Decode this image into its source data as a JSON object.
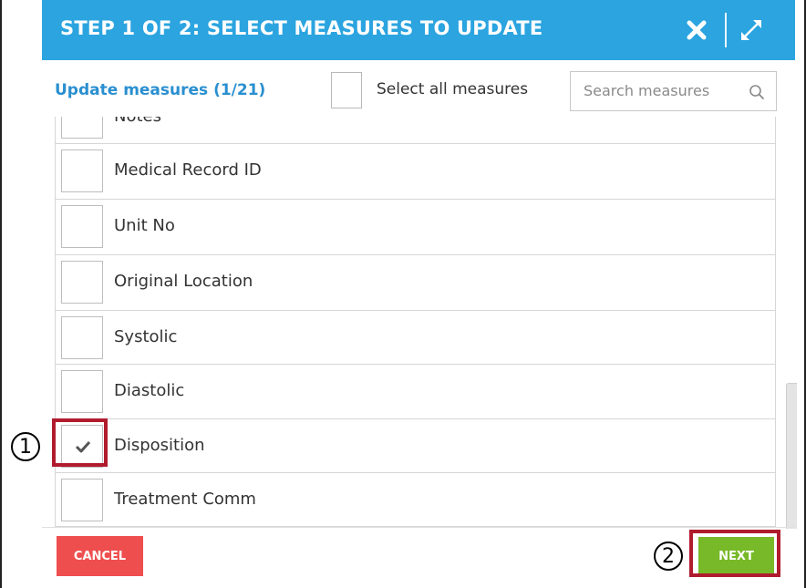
{
  "header": {
    "title": "STEP 1 OF 2: SELECT MEASURES TO UPDATE",
    "close_icon": "close-icon",
    "expand_icon": "expand-icon"
  },
  "toolbar": {
    "title": "Update measures (1/21)",
    "select_all_label": "Select all measures",
    "search_placeholder": "Search measures"
  },
  "measures": [
    {
      "label": "Notes",
      "checked": false
    },
    {
      "label": "Medical Record ID",
      "checked": false
    },
    {
      "label": "Unit No",
      "checked": false
    },
    {
      "label": "Original Location",
      "checked": false
    },
    {
      "label": "Systolic",
      "checked": false
    },
    {
      "label": "Diastolic",
      "checked": false
    },
    {
      "label": "Disposition",
      "checked": true
    },
    {
      "label": "Treatment Comm",
      "checked": false
    }
  ],
  "footer": {
    "cancel_label": "CANCEL",
    "next_label": "NEXT"
  },
  "annotations": {
    "step1": "1",
    "step2": "2"
  },
  "colors": {
    "header_bg": "#2ba4e0",
    "title_accent": "#2a8fd0",
    "cancel_bg": "#ef4e4e",
    "next_bg": "#77b928",
    "highlight": "#b01c2e"
  }
}
